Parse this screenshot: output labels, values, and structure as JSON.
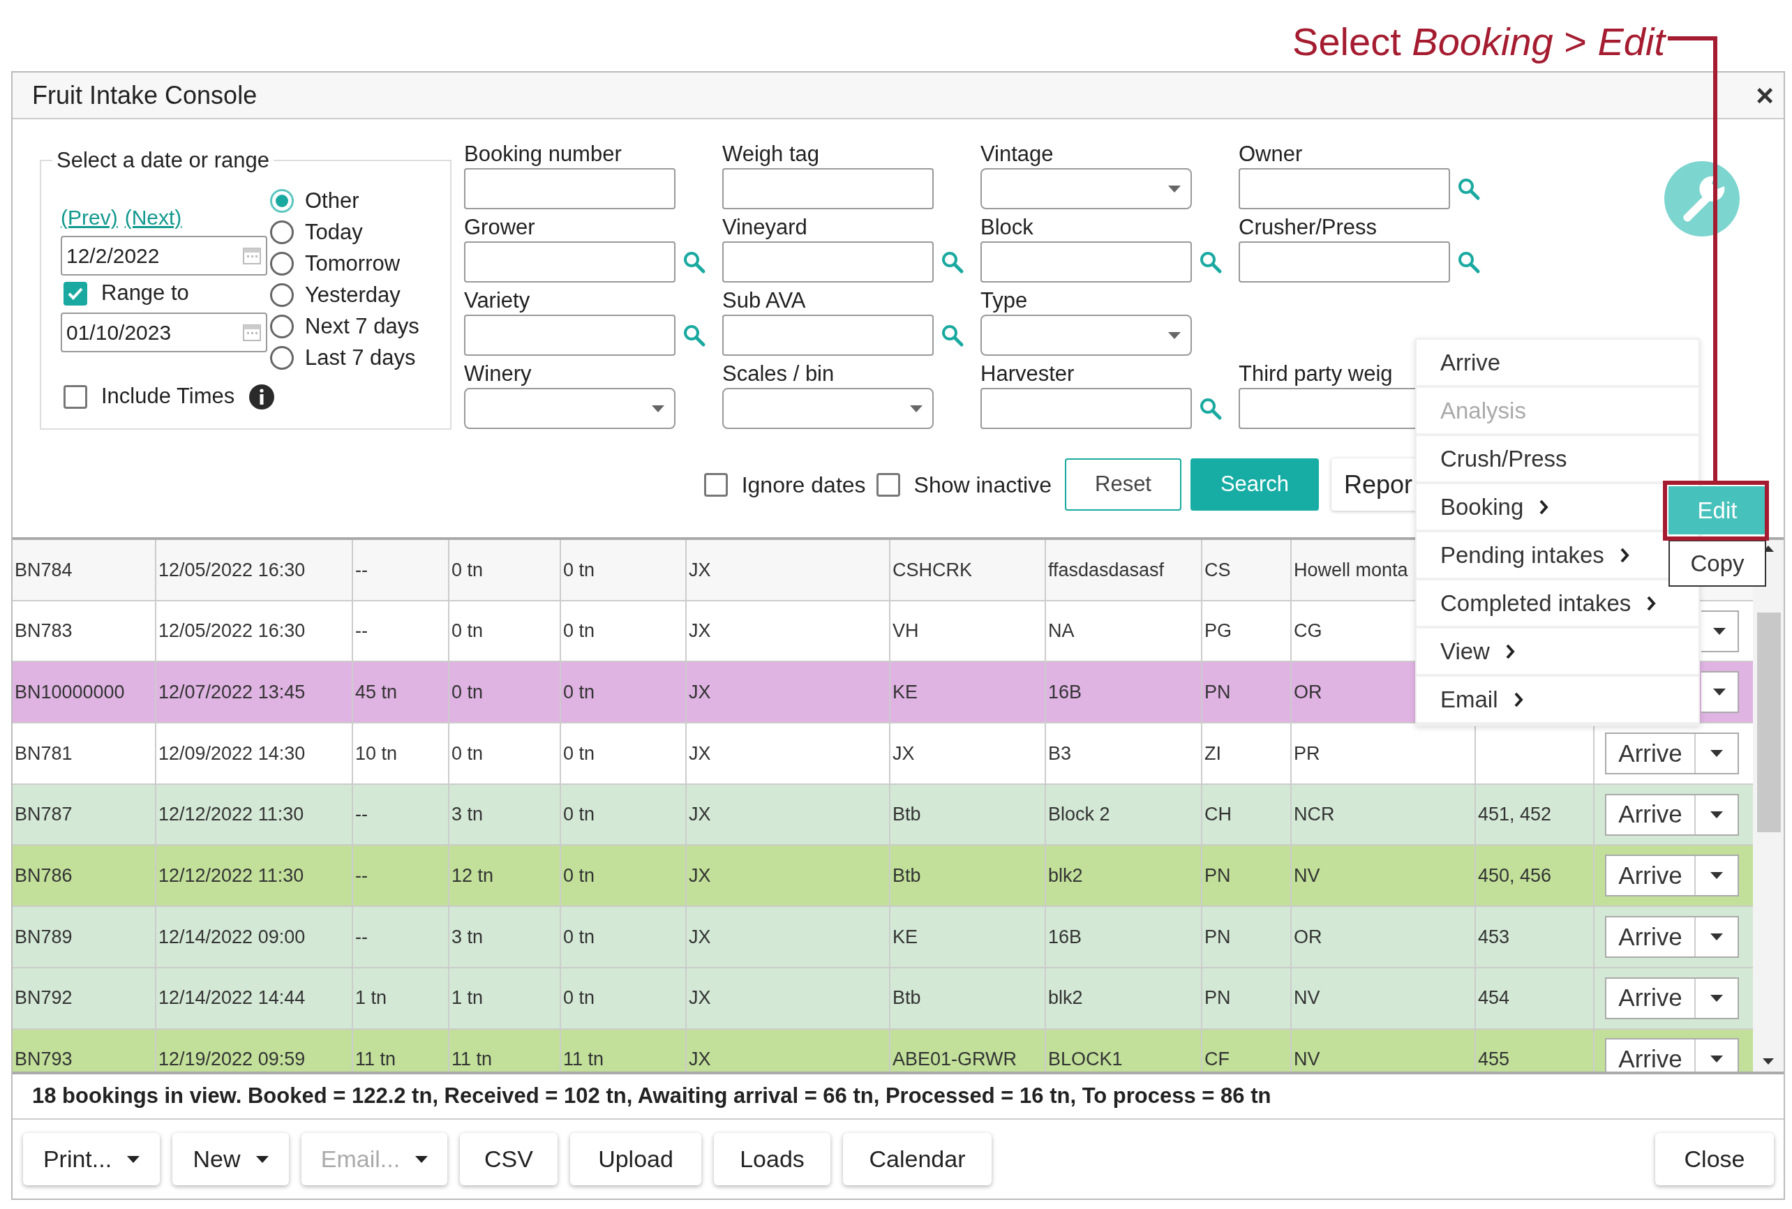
{
  "annotation": {
    "text": "Select *Booking* > *Edit*"
  },
  "window": {
    "title": "Fruit Intake Console",
    "close": "×"
  },
  "date_panel": {
    "legend": "Select a date or range",
    "links": [
      "(Prev)",
      "(Next)"
    ],
    "start_date": "12/2/2022",
    "range": {
      "label": "Range to",
      "checked": true
    },
    "end_date": "01/10/2023",
    "include_times": {
      "label": "Include Times",
      "checked": false
    },
    "presets": [
      {
        "label": "Other",
        "selected": true
      },
      {
        "label": "Today",
        "selected": false
      },
      {
        "label": "Tomorrow",
        "selected": false
      },
      {
        "label": "Yesterday",
        "selected": false
      },
      {
        "label": "Next 7 days",
        "selected": false
      },
      {
        "label": "Last 7 days",
        "selected": false
      }
    ]
  },
  "filter_rows": [
    [
      {
        "label": "Booking number",
        "kind": "text",
        "lookup": false
      },
      {
        "label": "Weigh tag",
        "kind": "text",
        "lookup": false
      },
      {
        "label": "Vintage",
        "kind": "select",
        "lookup": false
      },
      {
        "label": "Owner",
        "kind": "text",
        "lookup": true
      }
    ],
    [
      {
        "label": "Grower",
        "kind": "text",
        "lookup": true
      },
      {
        "label": "Vineyard",
        "kind": "text",
        "lookup": true
      },
      {
        "label": "Block",
        "kind": "text",
        "lookup": true
      },
      {
        "label": "Crusher/Press",
        "kind": "text",
        "lookup": true
      }
    ],
    [
      {
        "label": "Variety",
        "kind": "text",
        "lookup": true
      },
      {
        "label": "Sub AVA",
        "kind": "text",
        "lookup": true
      },
      {
        "label": "Type",
        "kind": "select",
        "lookup": false
      }
    ],
    [
      {
        "label": "Winery",
        "kind": "select",
        "lookup": false
      },
      {
        "label": "Scales / bin",
        "kind": "select",
        "lookup": false
      },
      {
        "label": "Harvester",
        "kind": "text",
        "lookup": true
      },
      {
        "label": "Third party weig",
        "kind": "text",
        "lookup": false
      }
    ]
  ],
  "options": [
    {
      "label": "Ignore dates",
      "checked": false
    },
    {
      "label": "Show inactive",
      "checked": false
    }
  ],
  "actions": [
    {
      "label": "Reset",
      "kind": "outline"
    },
    {
      "label": "Search",
      "kind": "primary"
    },
    {
      "label": "Repor",
      "kind": "plain"
    }
  ],
  "table": {
    "rows": [
      {
        "color": "#f7f7f7",
        "cells": [
          "BN784",
          "12/05/2022 16:30",
          "--",
          "0 tn",
          "0 tn",
          "JX",
          "CSHCRK",
          "ffasdasdasasf",
          "CS",
          "Howell monta"
        ]
      },
      {
        "color": "#ffffff",
        "cells": [
          "BN783",
          "12/05/2022 16:30",
          "--",
          "0 tn",
          "0 tn",
          "JX",
          "VH",
          "NA",
          "PG",
          "CG"
        ],
        "action": {
          "kind": "caret"
        }
      },
      {
        "color": "#dfb3e2",
        "cells": [
          "BN10000000",
          "12/07/2022 13:45",
          "45 tn",
          "0 tn",
          "0 tn",
          "JX",
          "KE",
          "16B",
          "PN",
          "OR"
        ],
        "action": {
          "kind": "caret"
        }
      },
      {
        "color": "#ffffff",
        "cells": [
          "BN781",
          "12/09/2022 14:30",
          "10 tn",
          "0 tn",
          "0 tn",
          "JX",
          "JX",
          "B3",
          "ZI",
          "PR"
        ],
        "action": {
          "kind": "split",
          "label": "Arrive"
        }
      },
      {
        "color": "#d4e8d6",
        "cells": [
          "BN787",
          "12/12/2022 11:30",
          "--",
          "3 tn",
          "0 tn",
          "JX",
          "Btb",
          "Block 2",
          "CH",
          "NCR"
        ],
        "column_11": "451, 452",
        "action": {
          "kind": "split",
          "label": "Arrive"
        }
      },
      {
        "color": "#c2e09a",
        "cells": [
          "BN786",
          "12/12/2022 11:30",
          "--",
          "12 tn",
          "0 tn",
          "JX",
          "Btb",
          "blk2",
          "PN",
          "NV"
        ],
        "column_11": "450, 456",
        "action": {
          "kind": "split",
          "label": "Arrive"
        }
      },
      {
        "color": "#d4e8d6",
        "cells": [
          "BN789",
          "12/14/2022 09:00",
          "--",
          "3 tn",
          "0 tn",
          "JX",
          "KE",
          "16B",
          "PN",
          "OR"
        ],
        "column_11": "453",
        "action": {
          "kind": "split",
          "label": "Arrive"
        }
      },
      {
        "color": "#d4e8d6",
        "cells": [
          "BN792",
          "12/14/2022 14:44",
          "1 tn",
          "1 tn",
          "0 tn",
          "JX",
          "Btb",
          "blk2",
          "PN",
          "NV"
        ],
        "column_11": "454",
        "action": {
          "kind": "split",
          "label": "Arrive"
        }
      },
      {
        "color": "#c2e09a",
        "cells": [
          "BN793",
          "12/19/2022 09:59",
          "11 tn",
          "11 tn",
          "11 tn",
          "JX",
          "ABE01-GRWR",
          "BLOCK1",
          "CF",
          "NV"
        ],
        "column_11": "455",
        "action": {
          "kind": "split",
          "label": "Arrive"
        }
      }
    ]
  },
  "status_bar": "18 bookings in view. Booked = 122.2 tn, Received = 102 tn, Awaiting arrival = 66 tn, Processed = 16 tn, To process = 86 tn",
  "footer_buttons": [
    {
      "label": "Print...",
      "kind": "dropdown",
      "disabled": false
    },
    {
      "label": "New",
      "kind": "dropdown",
      "disabled": false
    },
    {
      "label": "Email...",
      "kind": "dropdown",
      "disabled": true
    },
    {
      "label": "CSV",
      "kind": "plain",
      "disabled": false
    },
    {
      "label": "Upload",
      "kind": "plain",
      "disabled": false
    },
    {
      "label": "Loads",
      "kind": "plain",
      "disabled": false
    },
    {
      "label": "Calendar",
      "kind": "plain",
      "disabled": false
    }
  ],
  "close_button": "Close",
  "context_menu": {
    "items": [
      {
        "label": "Arrive",
        "disabled": false,
        "submenu": false
      },
      {
        "label": "Analysis",
        "disabled": true,
        "submenu": false
      },
      {
        "label": "Crush/Press",
        "disabled": false,
        "submenu": false
      },
      {
        "label": "Booking",
        "disabled": false,
        "submenu": true
      },
      {
        "label": "Pending intakes",
        "disabled": false,
        "submenu": true
      },
      {
        "label": "Completed intakes",
        "disabled": false,
        "submenu": true
      },
      {
        "label": "View",
        "disabled": false,
        "submenu": true
      },
      {
        "label": "Email",
        "disabled": false,
        "submenu": true
      }
    ],
    "submenu": [
      {
        "label": "Edit",
        "selected": true
      },
      {
        "label": "Copy",
        "selected": false
      }
    ]
  }
}
